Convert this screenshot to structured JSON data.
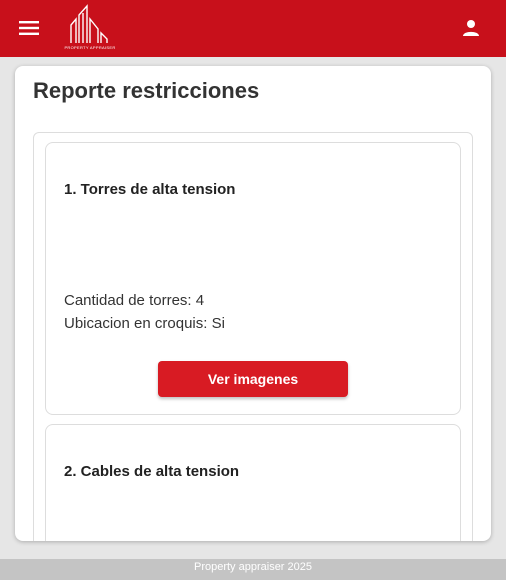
{
  "header": {
    "menu_icon": "menu-icon",
    "logo_text": "PROPERTY APPRAISER",
    "user_icon": "person-icon",
    "brand_color": "#c8101b"
  },
  "page": {
    "title": "Reporte restricciones"
  },
  "items": [
    {
      "title": "1. Torres de alta tension",
      "details": [
        "Cantidad de torres: 4",
        "Ubicacion en croquis: Si"
      ],
      "button_label": "Ver imagenes"
    },
    {
      "title": "2. Cables de alta tension"
    }
  ],
  "footer": {
    "text": "Property appraiser 2025"
  }
}
